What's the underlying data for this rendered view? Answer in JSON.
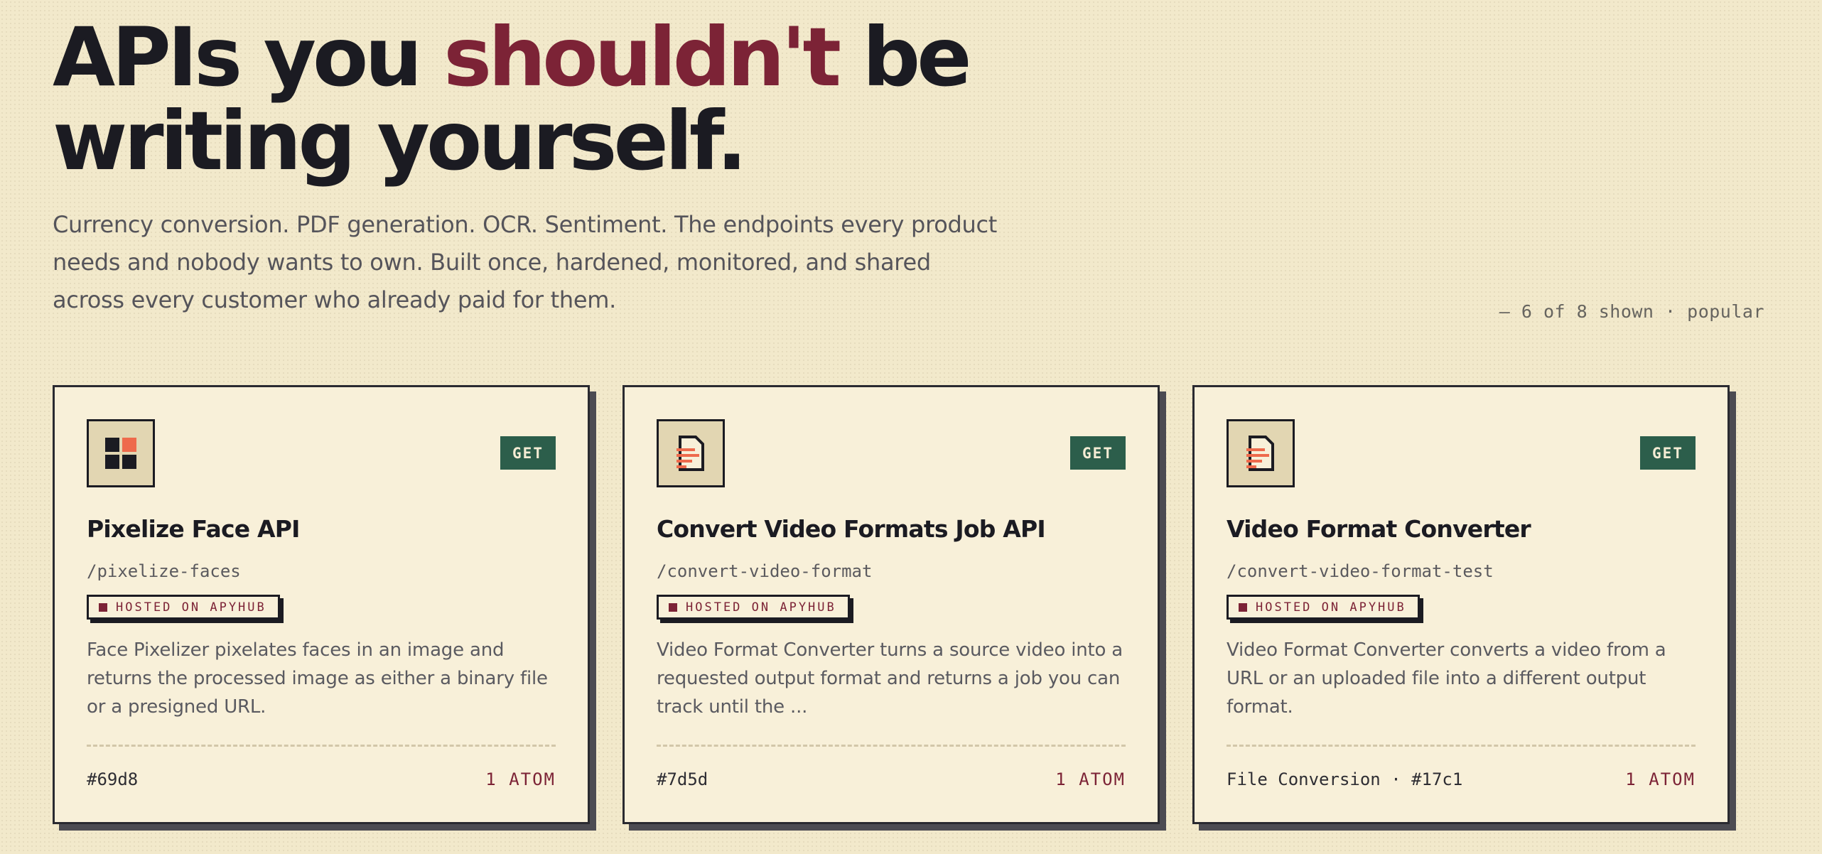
{
  "hero": {
    "title_part1": "APIs you ",
    "title_accent": "shouldn't",
    "title_part2": " be writing yourself.",
    "lede": "Currency conversion. PDF generation. OCR. Sentiment. The endpoints every product needs and nobody wants to own. Built once, hardened, monitored, and shared across every customer who already paid for them.",
    "shown_count": "— 6 of 8 shown · popular"
  },
  "colors": {
    "accent": "#7c2336",
    "get_badge": "#2c5e4b",
    "icon_highlight": "#ee6a4c"
  },
  "cards": [
    {
      "icon": "grid-tiles-icon",
      "badge": "GET",
      "title": "Pixelize Face API",
      "path": "/pixelize-faces",
      "hosted": "HOSTED ON APYHUB",
      "description": "Face Pixelizer pixelates faces in an image and returns the processed image as either a binary file or a presigned URL.",
      "meta": "#69d8",
      "price": "1 ATOM"
    },
    {
      "icon": "document-icon",
      "badge": "GET",
      "title": "Convert Video Formats Job API",
      "path": "/convert-video-format",
      "hosted": "HOSTED ON APYHUB",
      "description": "Video Format Converter turns a source video into a requested output format and returns a job you can track until the ...",
      "meta": "#7d5d",
      "price": "1 ATOM"
    },
    {
      "icon": "document-icon",
      "badge": "GET",
      "title": "Video Format Converter",
      "path": "/convert-video-format-test",
      "hosted": "HOSTED ON APYHUB",
      "description": "Video Format Converter converts a video from a URL or an uploaded file into a different output format.",
      "meta": "File Conversion · #17c1",
      "price": "1 ATOM"
    }
  ]
}
